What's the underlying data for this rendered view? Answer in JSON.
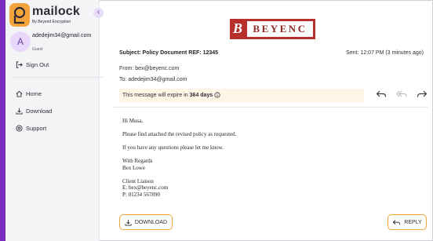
{
  "app": {
    "logo_name": "mailock",
    "logo_tagline": "By Beyend Encryption",
    "collapse_glyph": "‹"
  },
  "user": {
    "avatar_initial": "A",
    "email": "adedejim34@gmail.com",
    "role": "Guest"
  },
  "sidebar": {
    "sign_out": "Sign Out",
    "items": [
      {
        "label": "Home",
        "icon": "home-icon"
      },
      {
        "label": "Download",
        "icon": "download-icon"
      },
      {
        "label": "Support",
        "icon": "support-icon"
      }
    ]
  },
  "brand": {
    "letter": "B",
    "name": "BEYENC"
  },
  "email": {
    "subject": "Subject: Policy Document REF: 12345",
    "sent": "Sent: 12:07 PM (3 minutes ago)",
    "from": "From: bex@beyenc.com",
    "to": "To: adedejim34@gmail.com",
    "expiry_prefix": "This message will expire in",
    "expiry_value": "364 days",
    "body": {
      "greeting": "Hi Musa,",
      "line1": "Please find attached the revised policy as requested.",
      "line2": "If you have any questions please let me know.",
      "sign1": "With Regards",
      "sign2": "Bex Lowe",
      "title": "Client Liaison",
      "email_line": "E: bex@beyenc.com",
      "phone_line": "P: 01234 567890"
    }
  },
  "actions": {
    "download_label": "DOWNLOAD",
    "reply_label": "REPLY"
  },
  "colors": {
    "accent_purple": "#7b2cbf",
    "accent_orange": "#f2a33a",
    "brand_red": "#b7302b",
    "expiry_bg": "#fff5e6"
  }
}
